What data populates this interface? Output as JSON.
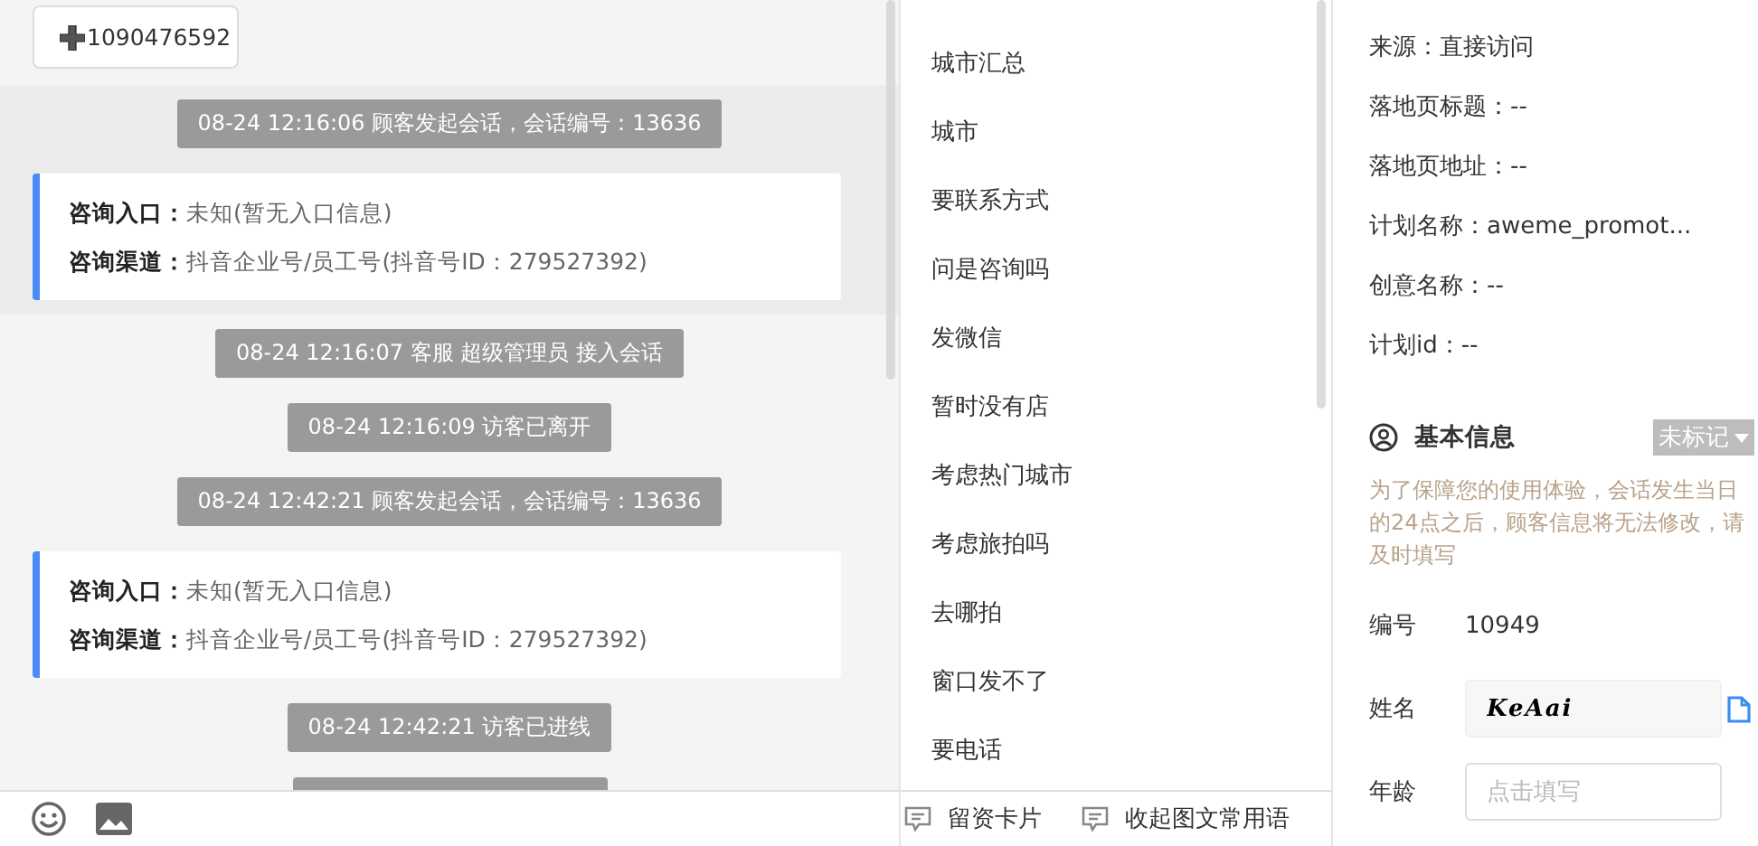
{
  "chat": {
    "tag_button": "1090476592",
    "groups": [
      {
        "highlighted": true,
        "messages": [
          {
            "kind": "system",
            "text": "08-24 12:16:06 顾客发起会话，会话编号：13636"
          },
          {
            "kind": "card",
            "rows": [
              {
                "label": "咨询入口：",
                "value": "未知(暂无入口信息)"
              },
              {
                "label": "咨询渠道：",
                "value": "抖音企业号/员工号(抖音号ID：279527392)"
              }
            ]
          }
        ]
      },
      {
        "highlighted": false,
        "messages": [
          {
            "kind": "system",
            "text": "08-24 12:16:07 客服 超级管理员 接入会话"
          },
          {
            "kind": "system",
            "text": "08-24 12:16:09 访客已离开"
          },
          {
            "kind": "system",
            "text": "08-24 12:42:21 顾客发起会话，会话编号：13636"
          },
          {
            "kind": "card",
            "rows": [
              {
                "label": "咨询入口：",
                "value": "未知(暂无入口信息)"
              },
              {
                "label": "咨询渠道：",
                "value": "抖音企业号/员工号(抖音号ID：279527392)"
              }
            ]
          },
          {
            "kind": "system",
            "text": "08-24 12:42:21 访客已进线"
          }
        ]
      }
    ]
  },
  "quick_replies": {
    "items": [
      "城市汇总",
      "城市",
      "要联系方式",
      "问是咨询吗",
      "发微信",
      "暂时没有店",
      "考虑热门城市",
      "考虑旅拍吗",
      "去哪拍",
      "窗口发不了",
      "要电话"
    ],
    "actions": [
      "留资卡片",
      "收起图文常用语"
    ]
  },
  "visitor": {
    "source_info": [
      "来源：直接访问",
      "落地页标题：--",
      "落地页地址：--",
      "计划名称：aweme_promot...",
      "创意名称：--",
      "计划id：--"
    ],
    "basic_info": {
      "title": "基本信息",
      "mark": "未标记",
      "note": "为了保障您的使用体验，会话发生当日的24点之后，顾客信息将无法修改，请及时填写",
      "fields": [
        {
          "kind": "text",
          "label": "编号",
          "value": "10949"
        },
        {
          "kind": "input",
          "label": "姓名",
          "value": "KeAai"
        },
        {
          "kind": "input",
          "label": "年龄",
          "placeholder": "点击填写"
        }
      ]
    }
  }
}
